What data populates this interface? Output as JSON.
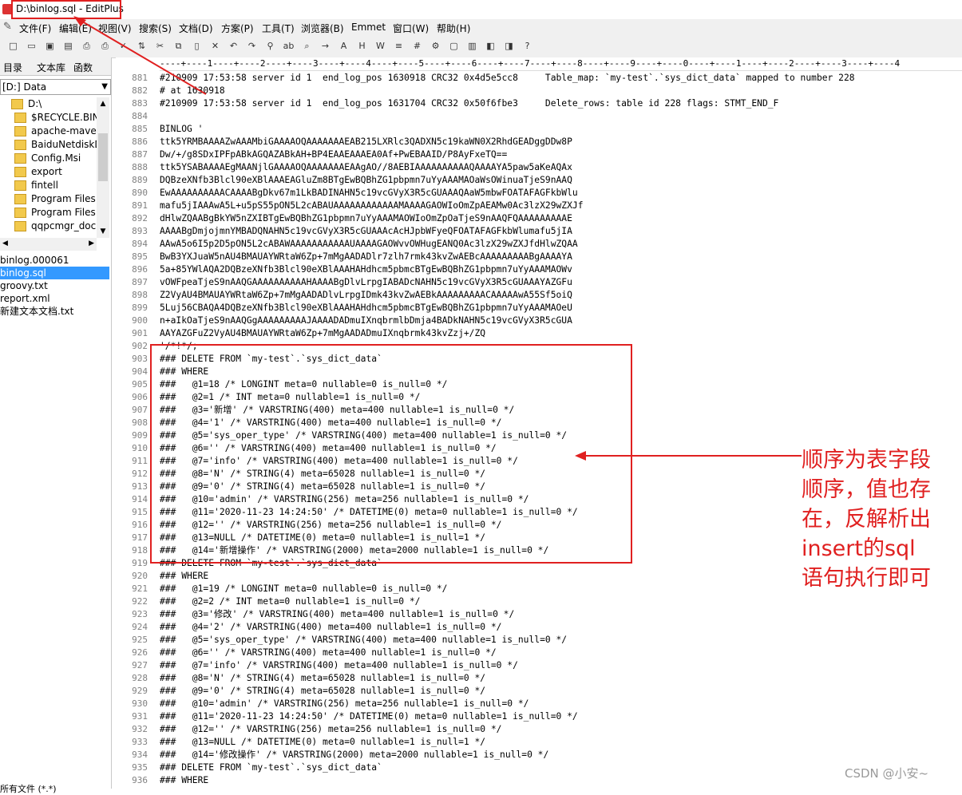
{
  "window": {
    "title": "D:\\binlog.sql - EditPlus"
  },
  "menu": [
    "文件(F)",
    "编辑(E)",
    "视图(V)",
    "搜索(S)",
    "文档(D)",
    "方案(P)",
    "工具(T)",
    "浏览器(B)",
    "Emmet",
    "窗口(W)",
    "帮助(H)"
  ],
  "toolbar_icons": [
    "new-file-icon",
    "open-icon",
    "save-icon",
    "save-all-icon",
    "print-preview-icon",
    "print-icon",
    "spell-check-icon",
    "ftp-icon",
    "cut-icon",
    "copy-icon",
    "paste-icon",
    "delete-icon",
    "undo-icon",
    "redo-icon",
    "find-icon",
    "replace-icon",
    "find-in-files-icon",
    "goto-icon",
    "font-icon",
    "html-toolbar-icon",
    "word-wrap-icon",
    "line-number-icon",
    "ruler-icon",
    "settings-icon",
    "window-icon",
    "column-icon",
    "browser-icon",
    "clip-icon",
    "help-icon"
  ],
  "sidebar": {
    "tabs": [
      "目录",
      "文本库",
      "函数"
    ],
    "drive": "[D:] Data",
    "folders": [
      "D:\\",
      "$RECYCLE.BIN",
      "apache-maven",
      "BaiduNetdiskD",
      "Config.Msi",
      "export",
      "fintell",
      "Program Files",
      "Program Files",
      "qqpcmgr_doc"
    ],
    "files": [
      {
        "name": "binlog.000061",
        "selected": false
      },
      {
        "name": "binlog.sql",
        "selected": true
      },
      {
        "name": "groovy.txt",
        "selected": false
      },
      {
        "name": "report.xml",
        "selected": false
      },
      {
        "name": "新建文本文档.txt",
        "selected": false
      }
    ],
    "footer": "所有文件 (*.*)"
  },
  "editor": {
    "ruler": "----+----1----+----2----+----3----+----4----+----5----+----6----+----7----+----8----+----9----+----0----+----1----+----2----+----3----+----4",
    "lines": [
      {
        "n": "881",
        "t": "#210909 17:53:58 server id 1  end_log_pos 1630918 CRC32 0x4d5e5cc8     Table_map: `my-test`.`sys_dict_data` mapped to number 228"
      },
      {
        "n": "882",
        "t": "# at 1630918"
      },
      {
        "n": "883",
        "t": "#210909 17:53:58 server id 1  end_log_pos 1631704 CRC32 0x50f6fbe3     Delete_rows: table id 228 flags: STMT_END_F"
      },
      {
        "n": "884",
        "t": ""
      },
      {
        "n": "885",
        "t": "BINLOG '"
      },
      {
        "n": "886",
        "t": "ttk5YRMBAAAAZwAAAMbiGAAAAOQAAAAAAAEAB215LXRlc3QADXN5c19kaWN0X2RhdGEADggDDw8P"
      },
      {
        "n": "887",
        "t": "Dw/+/g8SDxIPFpABkAGQAZABkAH+BP4EAAEAAAEA0Af+PwEBAAID/P8AyFxeTQ=="
      },
      {
        "n": "888",
        "t": "ttk5YSABAAAAEgMAANjlGAAAAOQAAAAAAAEAAgAO//8AEBIAAAAAAAAAAQAAAAYA5paw5aKeAQAx"
      },
      {
        "n": "889",
        "t": "DQBzeXNfb3Blcl90eXBlAAAEAGluZm8BTgEwBQBhZG1pbpmn7uYyAAAMAOaWsOWinuaTjeS9nAAQ"
      },
      {
        "n": "890",
        "t": "EwAAAAAAAAAACAAAABgDkv67m1LkBADINAHN5c19vcGVyX3R5cGUAAAQAaW5mbwFOATAFAGFkbWlu"
      },
      {
        "n": "891",
        "t": "mafu5jIAAAwA5L+u5pS55pON5L2cABAUAAAAAAAAAAAAMAAAAGAOWIoOmZpAEAMw0Ac3lzX29wZXJf"
      },
      {
        "n": "892",
        "t": "dHlwZQAABgBkYW5nZXIBTgEwBQBhZG1pbpmn7uYyAAAMAOWIoOmZpOaTjeS9nAAQFQAAAAAAAAAE"
      },
      {
        "n": "893",
        "t": "AAAABgDmjojmnYMBADQNAHN5c19vcGVyX3R5cGUAAAcAcHJpbWFyeQFOATAFAGFkbWlumafu5jIA"
      },
      {
        "n": "894",
        "t": "AAwA5o6I5p2D5pON5L2cABAWAAAAAAAAAAAUAAAAGAOWvvOWHugEANQ0Ac3lzX29wZXJfdHlwZQAA"
      },
      {
        "n": "895",
        "t": "BwB3YXJuaW5nAU4BMAUAYWRtaW6Zp+7mMgAADADlr7zlh7rmk43kvZwAEBcAAAAAAAAABgAAAAYA"
      },
      {
        "n": "896",
        "t": "5a+85YWlAQA2DQBzeXNfb3Blcl90eXBlAAAHAHdhcm5pbmcBTgEwBQBhZG1pbpmn7uYyAAAMAOWv"
      },
      {
        "n": "897",
        "t": "vOWFpeaTjeS9nAAQGAAAAAAAAAAHAAAABgDlvLrpgIABADcNAHN5c19vcGVyX3R5cGUAAAYAZGFu"
      },
      {
        "n": "898",
        "t": "Z2VyAU4BMAUAYWRtaW6Zp+7mMgAADADlvLrpgIDmk43kvZwAEBkAAAAAAAAACAAAAAwA55Sf5oiQ"
      },
      {
        "n": "899",
        "t": "5Luj56CBAQA4DQBzeXNfb3Blcl90eXBlAAAHAHdhcm5pbmcBTgEwBQBhZG1pbpmn7uYyAAAMAOeU"
      },
      {
        "n": "900",
        "t": "n+aIkOaTjeS9nAAQGgAAAAAAAAAJAAAADADmuIXnqbrmlbDmja4BADkNAHN5c19vcGVyX3R5cGUA"
      },
      {
        "n": "901",
        "t": "AAYAZGFuZ2VyAU4BMAUAYWRtaW6Zp+7mMgAADADmuIXnqbrmk43kvZzj+/ZQ"
      },
      {
        "n": "902",
        "t": "'/*!*/;"
      },
      {
        "n": "903",
        "t": "### DELETE FROM `my-test`.`sys_dict_data`"
      },
      {
        "n": "904",
        "t": "### WHERE"
      },
      {
        "n": "905",
        "t": "###   @1=18 /* LONGINT meta=0 nullable=0 is_null=0 */"
      },
      {
        "n": "906",
        "t": "###   @2=1 /* INT meta=0 nullable=1 is_null=0 */"
      },
      {
        "n": "907",
        "t": "###   @3='新增' /* VARSTRING(400) meta=400 nullable=1 is_null=0 */"
      },
      {
        "n": "908",
        "t": "###   @4='1' /* VARSTRING(400) meta=400 nullable=1 is_null=0 */"
      },
      {
        "n": "909",
        "t": "###   @5='sys_oper_type' /* VARSTRING(400) meta=400 nullable=1 is_null=0 */"
      },
      {
        "n": "910",
        "t": "###   @6='' /* VARSTRING(400) meta=400 nullable=1 is_null=0 */"
      },
      {
        "n": "911",
        "t": "###   @7='info' /* VARSTRING(400) meta=400 nullable=1 is_null=0 */"
      },
      {
        "n": "912",
        "t": "###   @8='N' /* STRING(4) meta=65028 nullable=1 is_null=0 */"
      },
      {
        "n": "913",
        "t": "###   @9='0' /* STRING(4) meta=65028 nullable=1 is_null=0 */"
      },
      {
        "n": "914",
        "t": "###   @10='admin' /* VARSTRING(256) meta=256 nullable=1 is_null=0 */"
      },
      {
        "n": "915",
        "t": "###   @11='2020-11-23 14:24:50' /* DATETIME(0) meta=0 nullable=1 is_null=0 */"
      },
      {
        "n": "916",
        "t": "###   @12='' /* VARSTRING(256) meta=256 nullable=1 is_null=0 */"
      },
      {
        "n": "917",
        "t": "###   @13=NULL /* DATETIME(0) meta=0 nullable=1 is_null=1 */"
      },
      {
        "n": "918",
        "t": "###   @14='新增操作' /* VARSTRING(2000) meta=2000 nullable=1 is_null=0 */"
      },
      {
        "n": "919",
        "t": "### DELETE FROM `my-test`.`sys_dict_data`"
      },
      {
        "n": "920",
        "t": "### WHERE"
      },
      {
        "n": "921",
        "t": "###   @1=19 /* LONGINT meta=0 nullable=0 is_null=0 */"
      },
      {
        "n": "922",
        "t": "###   @2=2 /* INT meta=0 nullable=1 is_null=0 */"
      },
      {
        "n": "923",
        "t": "###   @3='修改' /* VARSTRING(400) meta=400 nullable=1 is_null=0 */"
      },
      {
        "n": "924",
        "t": "###   @4='2' /* VARSTRING(400) meta=400 nullable=1 is_null=0 */"
      },
      {
        "n": "925",
        "t": "###   @5='sys_oper_type' /* VARSTRING(400) meta=400 nullable=1 is_null=0 */"
      },
      {
        "n": "926",
        "t": "###   @6='' /* VARSTRING(400) meta=400 nullable=1 is_null=0 */"
      },
      {
        "n": "927",
        "t": "###   @7='info' /* VARSTRING(400) meta=400 nullable=1 is_null=0 */"
      },
      {
        "n": "928",
        "t": "###   @8='N' /* STRING(4) meta=65028 nullable=1 is_null=0 */"
      },
      {
        "n": "929",
        "t": "###   @9='0' /* STRING(4) meta=65028 nullable=1 is_null=0 */"
      },
      {
        "n": "930",
        "t": "###   @10='admin' /* VARSTRING(256) meta=256 nullable=1 is_null=0 */"
      },
      {
        "n": "931",
        "t": "###   @11='2020-11-23 14:24:50' /* DATETIME(0) meta=0 nullable=1 is_null=0 */"
      },
      {
        "n": "932",
        "t": "###   @12='' /* VARSTRING(256) meta=256 nullable=1 is_null=0 */"
      },
      {
        "n": "933",
        "t": "###   @13=NULL /* DATETIME(0) meta=0 nullable=1 is_null=1 */"
      },
      {
        "n": "934",
        "t": "###   @14='修改操作' /* VARSTRING(2000) meta=2000 nullable=1 is_null=0 */"
      },
      {
        "n": "935",
        "t": "### DELETE FROM `my-test`.`sys_dict_data`"
      },
      {
        "n": "936",
        "t": "### WHERE"
      }
    ]
  },
  "annotation": {
    "lines": [
      "顺序为表字段",
      "顺序，值也存",
      "在，反解析出",
      "insert的sql",
      "语句执行即可"
    ],
    "color": "#e02020"
  },
  "watermark": "CSDN @小安~"
}
